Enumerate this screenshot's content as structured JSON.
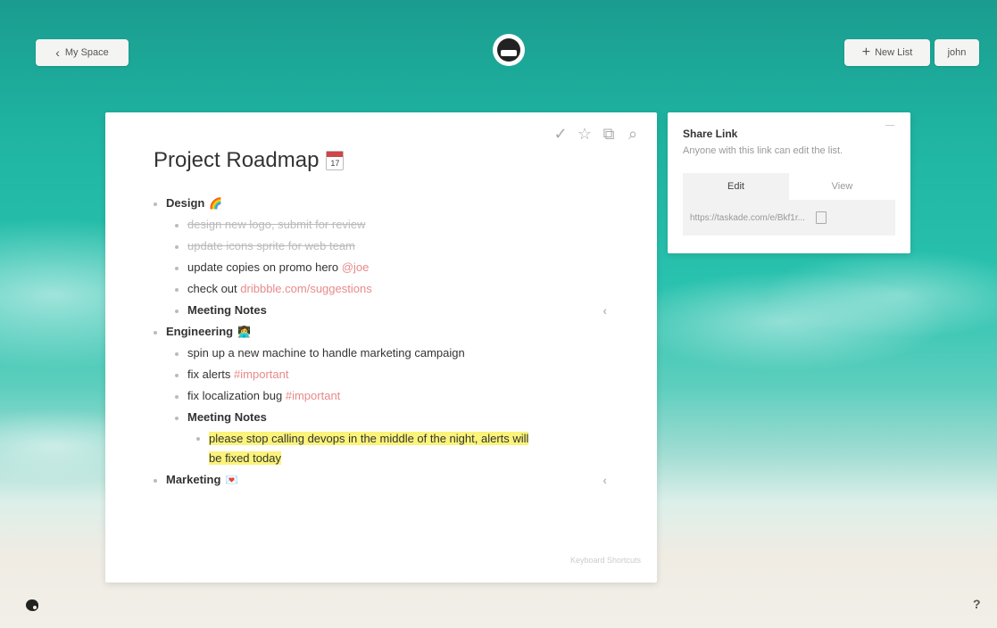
{
  "header": {
    "back_label": "My Space",
    "new_list_label": "New List",
    "user_label": "john"
  },
  "card": {
    "title": "Project Roadmap",
    "title_emoji": "17",
    "keyboard_shortcuts": "Keyboard Shortcuts",
    "tools": [
      "check-icon",
      "star-icon",
      "copy-icon",
      "search-icon"
    ]
  },
  "items": {
    "design": {
      "label": "Design",
      "emoji": "🌈"
    },
    "design_1": "design new logo, submit for review",
    "design_2": "update icons sprite for web team",
    "design_3_text": "update copies on promo hero",
    "design_3_tag": "@joe",
    "design_4_text": "check out",
    "design_4_link": "dribbble.com/suggestions",
    "design_notes": "Meeting Notes",
    "engineering": {
      "label": "Engineering",
      "emoji": "👩‍💻"
    },
    "eng_1": "spin up a new machine to handle marketing campaign",
    "eng_2_text": "fix alerts",
    "eng_2_tag": "#important",
    "eng_3_text": "fix localization bug",
    "eng_3_tag": "#important",
    "eng_notes": "Meeting Notes",
    "eng_note_1_line1": "please stop calling devops in the middle of the night, alerts will",
    "eng_note_1_line2": "be fixed today",
    "marketing": {
      "label": "Marketing",
      "emoji": "💌"
    }
  },
  "share": {
    "title": "Share Link",
    "subtitle": "Anyone with this link can edit the list.",
    "tab_edit": "Edit",
    "tab_view": "View",
    "url": "https://taskade.com/e/Bkf1r..."
  },
  "footer": {
    "help": "?"
  }
}
